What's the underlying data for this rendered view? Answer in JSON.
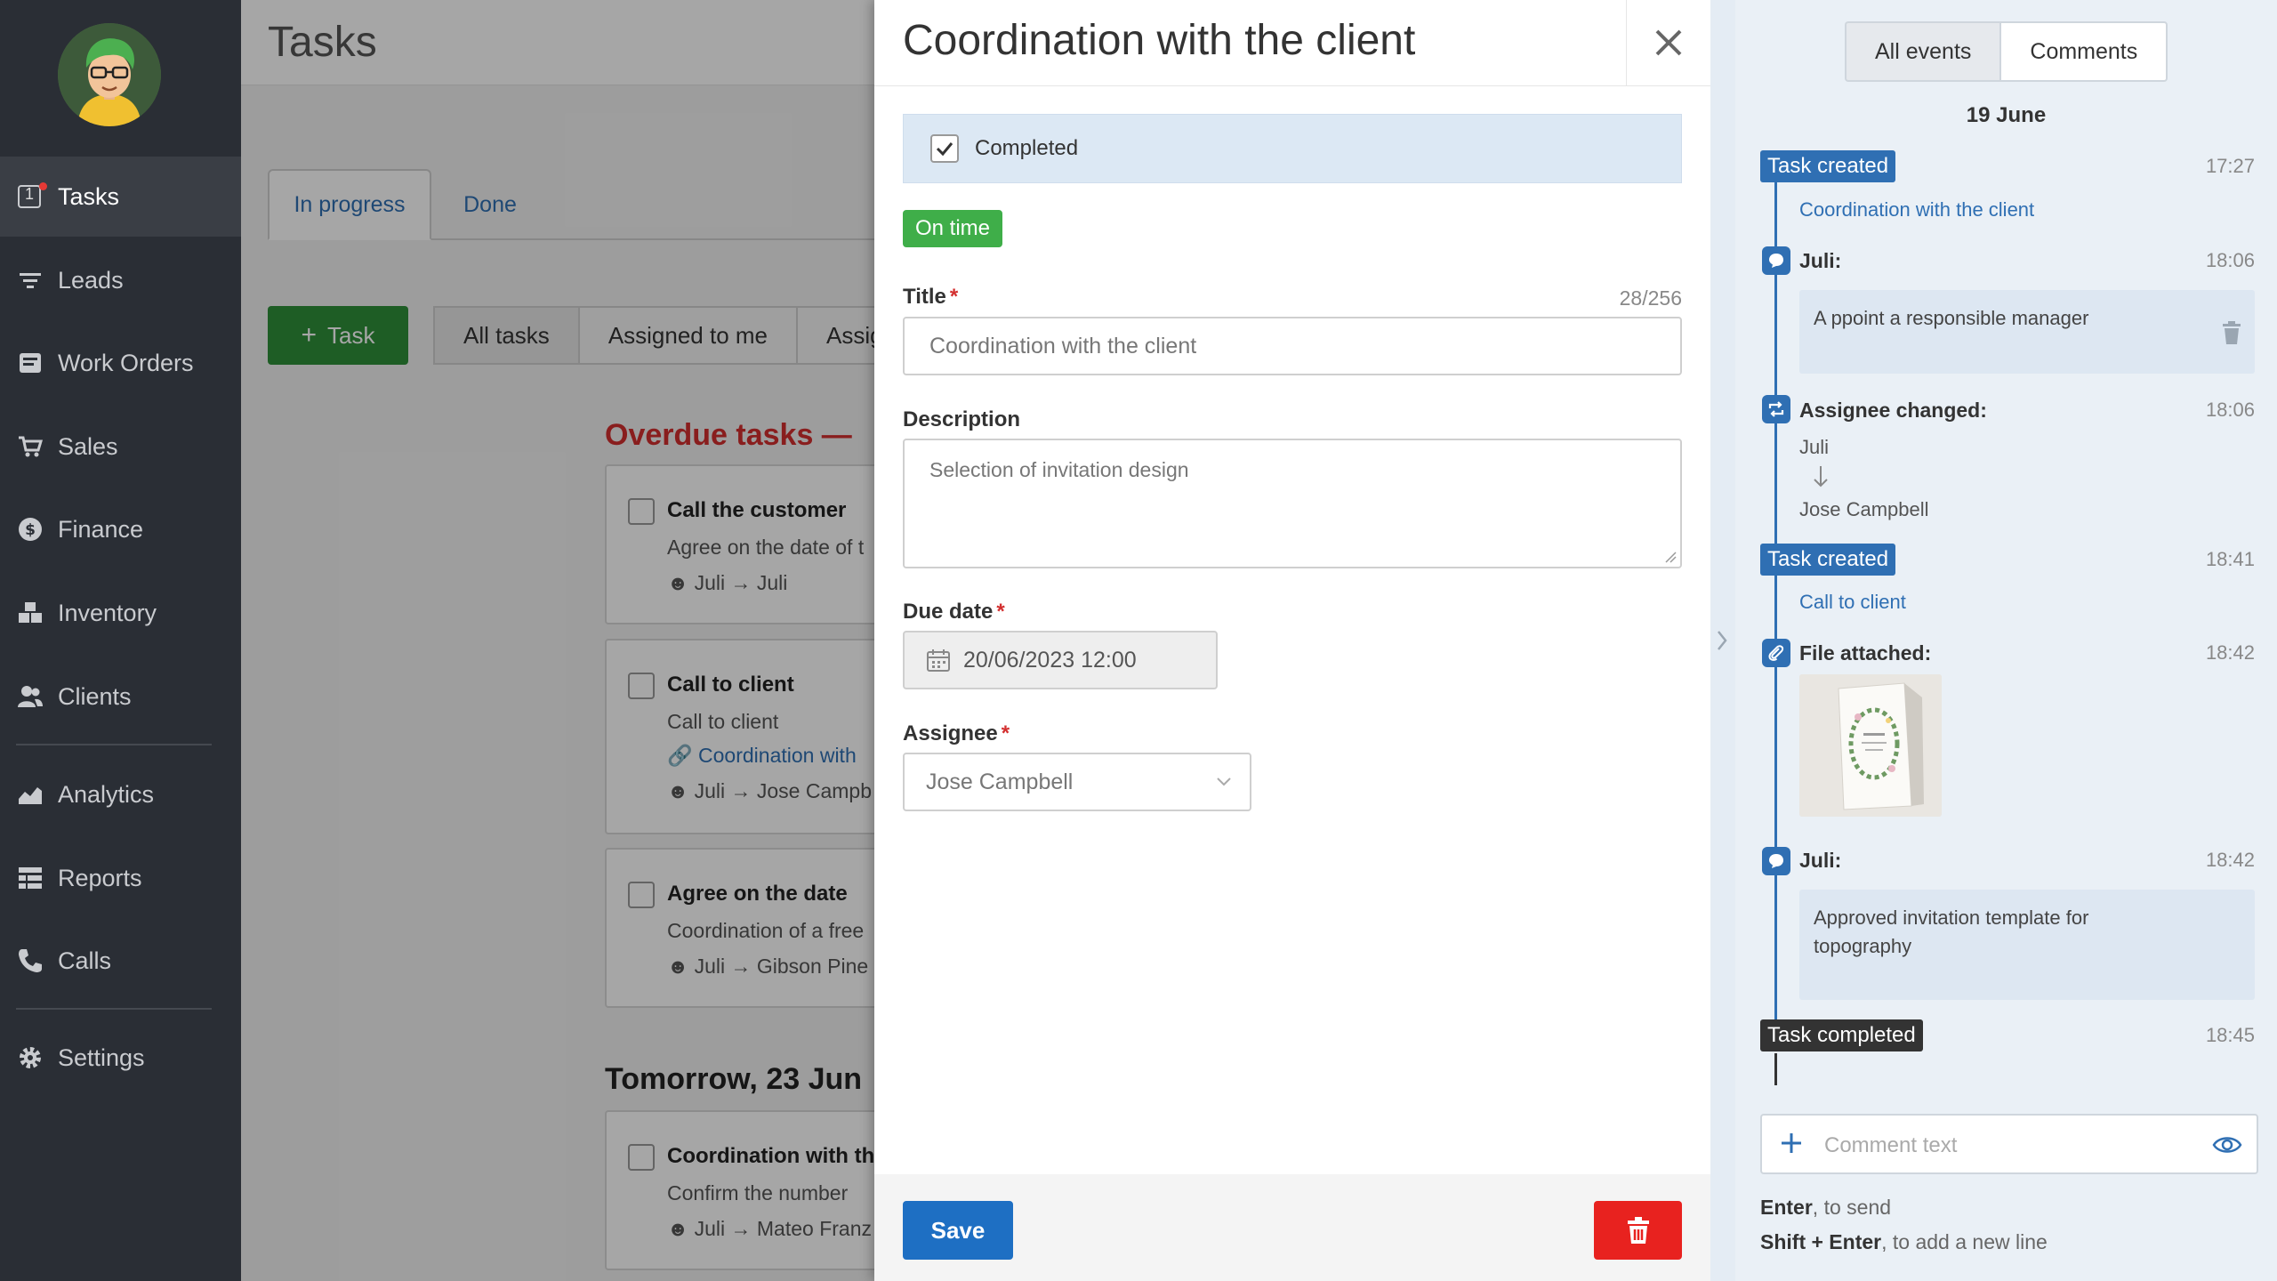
{
  "sidebar": {
    "items": [
      {
        "label": "Tasks",
        "icon": "tasks-icon",
        "badge": "1"
      },
      {
        "label": "Leads",
        "icon": "filter-icon"
      },
      {
        "label": "Work Orders",
        "icon": "work-orders-icon"
      },
      {
        "label": "Sales",
        "icon": "cart-icon"
      },
      {
        "label": "Finance",
        "icon": "dollar-icon"
      },
      {
        "label": "Inventory",
        "icon": "inventory-icon"
      },
      {
        "label": "Clients",
        "icon": "users-icon"
      },
      {
        "label": "Analytics",
        "icon": "chart-icon"
      },
      {
        "label": "Reports",
        "icon": "reports-icon"
      },
      {
        "label": "Calls",
        "icon": "phone-icon"
      },
      {
        "label": "Settings",
        "icon": "gear-icon"
      }
    ]
  },
  "tasks_page": {
    "title": "Tasks",
    "tabs": [
      "In progress",
      "Done"
    ],
    "add_task_label": "Task",
    "filters": [
      "All tasks",
      "Assigned to me",
      "Assig"
    ],
    "overdue_heading": "Overdue tasks —",
    "tomorrow_heading": "Tomorrow, 23 Jun",
    "cards": [
      {
        "title": "Call the customer",
        "desc": "Agree on the date of t",
        "people": "Juli → Juli"
      },
      {
        "title": "Call to client",
        "desc": "Call to client",
        "link": "Coordination with",
        "people": "Juli → Jose Campb"
      },
      {
        "title": "Agree on the date",
        "desc": "Coordination of a free",
        "people": "Juli → Gibson Pine"
      },
      {
        "title": "Coordination with th",
        "desc": "Confirm the number",
        "people": "Juli → Mateo Franz"
      }
    ]
  },
  "modal": {
    "title": "Coordination with the client",
    "completed_label": "Completed",
    "completed": true,
    "status_badge": "On time",
    "title_field": {
      "label": "Title",
      "value": "Coordination with the client",
      "count": "28/256"
    },
    "description_field": {
      "label": "Description",
      "value": "Selection of invitation design"
    },
    "due_date_field": {
      "label": "Due date",
      "value": "20/06/2023 12:00"
    },
    "assignee_field": {
      "label": "Assignee",
      "value": "Jose Campbell"
    },
    "save_label": "Save"
  },
  "events_panel": {
    "tabs": [
      "All events",
      "Comments"
    ],
    "date": "19 June",
    "events": [
      {
        "type": "badge",
        "label": "Task created",
        "time": "17:27",
        "link": "Coordination with the client"
      },
      {
        "type": "comment",
        "author": "Juli:",
        "time": "18:06",
        "text": "A ppoint a responsible manager"
      },
      {
        "type": "assignee",
        "label": "Assignee changed:",
        "time": "18:06",
        "from": "Juli",
        "to": "Jose Campbell"
      },
      {
        "type": "badge",
        "label": "Task created",
        "time": "18:41",
        "link": "Call to client"
      },
      {
        "type": "file",
        "label": "File attached:",
        "time": "18:42"
      },
      {
        "type": "comment",
        "author": "Juli:",
        "time": "18:42",
        "text": "Approved invitation template for topography"
      },
      {
        "type": "badge",
        "label": "Task completed",
        "time": "18:45"
      }
    ],
    "comment_placeholder": "Comment text",
    "hint_enter_key": "Enter",
    "hint_enter": ", to send",
    "hint_shift_key": "Shift + Enter",
    "hint_shift": ", to add a new line"
  },
  "colors": {
    "accent": "#2f6fb3",
    "success": "#3fae49",
    "danger": "#e8221f",
    "overdue": "#d32f2f",
    "sidebar": "#2a2e35"
  }
}
